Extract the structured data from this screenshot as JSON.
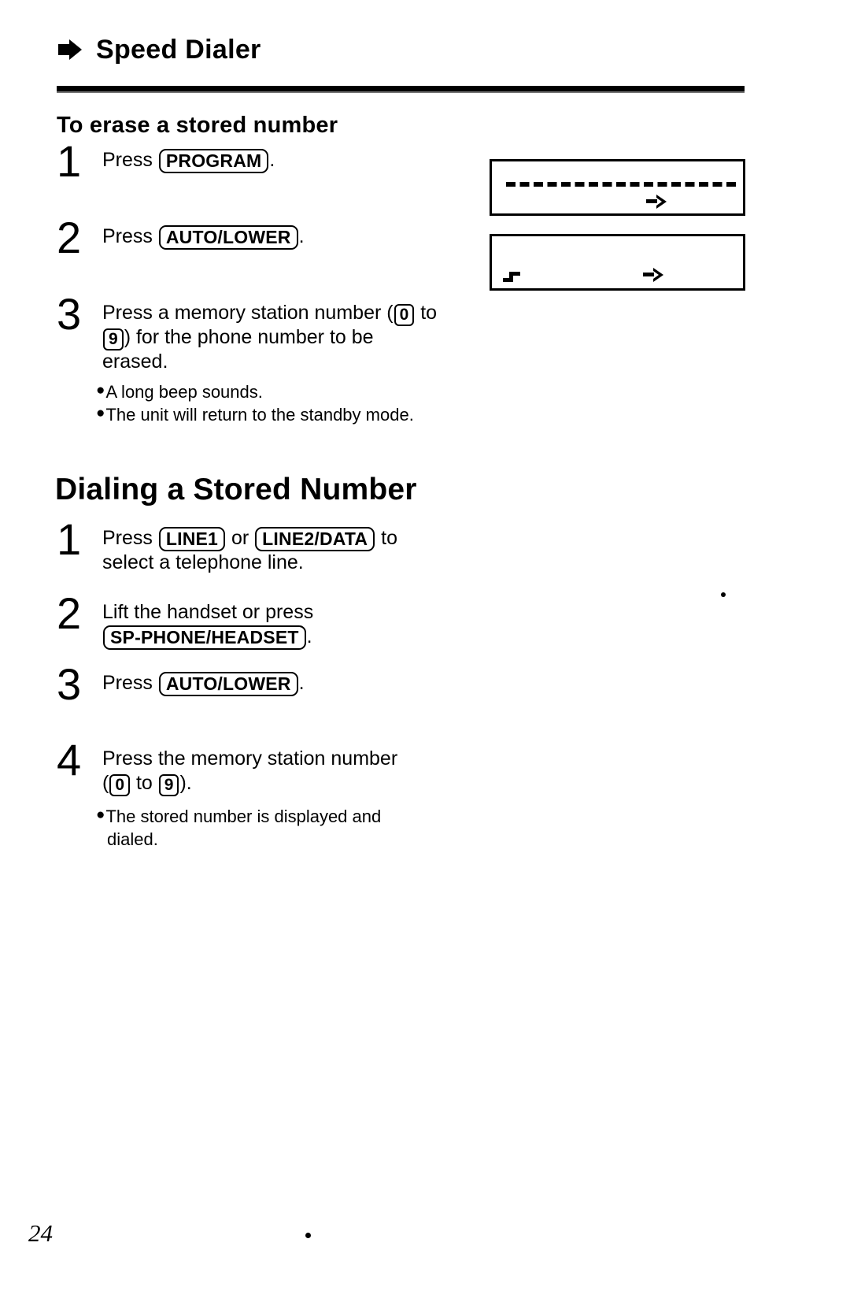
{
  "running_head": {
    "icon": "right-arrow-bullet-icon",
    "title": "Speed Dialer"
  },
  "section_erase": {
    "heading": "To erase a stored number",
    "steps": [
      {
        "number": "1",
        "text_before": "Press ",
        "key": "PROGRAM",
        "text_after": "."
      },
      {
        "number": "2",
        "text_before": "Press ",
        "key": "AUTO/LOWER",
        "text_after": "."
      },
      {
        "number": "3",
        "line1_before": "Press a memory station number (",
        "key_low": "0",
        "line1_mid": " to",
        "line2_key": "9",
        "line2_after": ") for the phone number to be",
        "line3": "erased."
      }
    ],
    "notes": [
      "A long beep sounds.",
      "The unit will return to the standby mode."
    ]
  },
  "displays": [
    {
      "name": "lcd-display-dashes",
      "content": "- - - - - - - - - - - - - -",
      "indicator": "right-arrow-indicator"
    },
    {
      "name": "lcd-display-blank",
      "content": "",
      "left_glyph": "lowercase-step-glyph",
      "indicator": "right-arrow-indicator"
    }
  ],
  "section_dial": {
    "heading": "Dialing a Stored Number",
    "steps": [
      {
        "number": "1",
        "line1_before": "Press ",
        "key1": "LINE1",
        "line1_mid": " or ",
        "key2": "LINE2/DATA",
        "line1_after": " to",
        "line2": "select a telephone line."
      },
      {
        "number": "2",
        "line1": "Lift the handset or press",
        "key": "SP-PHONE/HEADSET",
        "line2_after": "."
      },
      {
        "number": "3",
        "text_before": "Press ",
        "key": "AUTO/LOWER",
        "text_after": "."
      },
      {
        "number": "4",
        "line1": "Press the memory station number",
        "line2_before": "(",
        "key_low": "0",
        "line2_mid": " to ",
        "key_high": "9",
        "line2_after": ")."
      }
    ],
    "notes": [
      "The stored number is displayed and",
      "dialed."
    ]
  },
  "folio": "24"
}
